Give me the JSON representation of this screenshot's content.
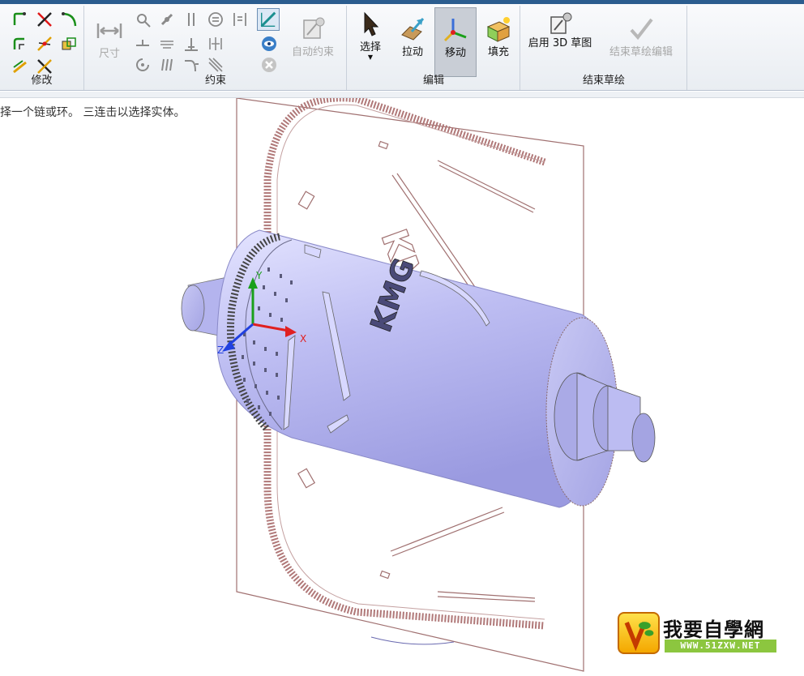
{
  "ribbon": {
    "groups": [
      {
        "label": "修改"
      },
      {
        "label": "约束"
      },
      {
        "label": "编辑"
      },
      {
        "label": "结束草绘"
      }
    ],
    "dimension_label": "尺寸",
    "auto_constraint_label": "自动约束",
    "select_label": "选择",
    "pull_label": "拉动",
    "move_label": "移动",
    "fill_label": "填充",
    "enable_3d_sketch_label": "启用 3D 草图",
    "finish_sketch_edit_label": "结束草绘编辑"
  },
  "status": {
    "text": "择一个链或环。 三连击以选择实体。"
  },
  "viewport": {
    "triad": {
      "x_label": "X",
      "y_label": "Y",
      "z_label": "Z"
    },
    "engraved_text": "KMG"
  },
  "watermark": {
    "title": "我要自學網",
    "url": "WWW.51ZXW.NET"
  },
  "colors": {
    "title_bar": "#2b5d8f",
    "part_body": "#b8b8f0",
    "sketch_lines": "#a07070",
    "axis_x": "#e02020",
    "axis_y": "#1aa01a",
    "axis_z": "#2040e0"
  }
}
